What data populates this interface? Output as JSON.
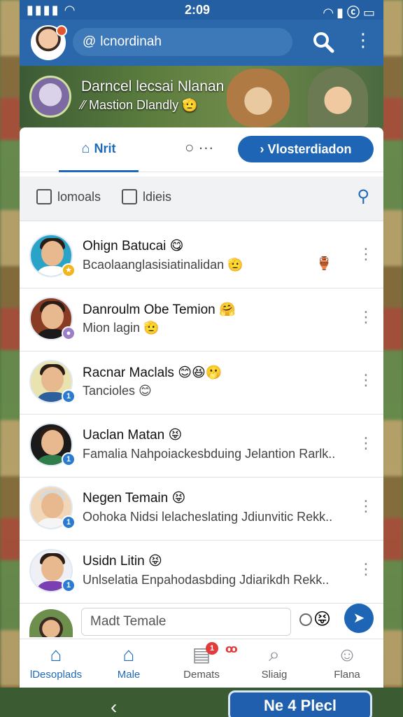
{
  "status_bar": {
    "time": "2:09"
  },
  "header": {
    "search_text": "lcnordinah",
    "icons": [
      "avatar",
      "search-icon",
      "more-vertical-icon"
    ]
  },
  "banner": {
    "title": "Darncel lecsai Nlanan",
    "subtitle": "Mastion Dlandly"
  },
  "tabs": {
    "active_label": "Nrit",
    "cta_label": "Vlosterdiadon"
  },
  "filters": [
    {
      "label": "lomoals"
    },
    {
      "label": "ldieis"
    }
  ],
  "chats": [
    {
      "name": "Ohign Batucai 😋",
      "preview": "Bcaolaanglasisiatinalidan 🫡",
      "badge_color": "#f2b51e"
    },
    {
      "name": "Danroulm Obe Temion 🤗",
      "preview": "Mion lagin 🫡",
      "badge_color": "#9b7fc9"
    },
    {
      "name": "Racnar Maclals 😊😆🫢",
      "preview": "Tancioles 😊",
      "badge_color": "#2a7bd1"
    },
    {
      "name": "Uaclan Matan 😝",
      "preview": "Famalia Nahpoiackesbduing Jelantion Rarlk..",
      "badge_color": "#2a7bd1"
    },
    {
      "name": "Negen Temain 😝",
      "preview": "Oohoka Nidsi lelacheslating Jdiunvitic Rekk..",
      "badge_color": "#2a7bd1"
    },
    {
      "name": "Usidn Litin 😝",
      "preview": "Unlselatia Enpahodasbding Jdiarikdh Rekk..",
      "badge_color": "#2a7bd1"
    }
  ],
  "composer": {
    "placeholder": "Madt Temale"
  },
  "bottom_nav": [
    {
      "label": "lDesoplads",
      "icon": "home-icon"
    },
    {
      "label": "Male",
      "icon": "home-icon"
    },
    {
      "label": "Demats",
      "icon": "list-icon",
      "badge": "1"
    },
    {
      "label": "Sliaig",
      "icon": "search-doc-icon"
    },
    {
      "label": "Flana",
      "icon": "person-icon"
    }
  ],
  "game_button": "Ne 4 Plecl",
  "colors": {
    "primary": "#1e66b5",
    "header": "#2a68ab",
    "statusbar": "#235fa2"
  }
}
